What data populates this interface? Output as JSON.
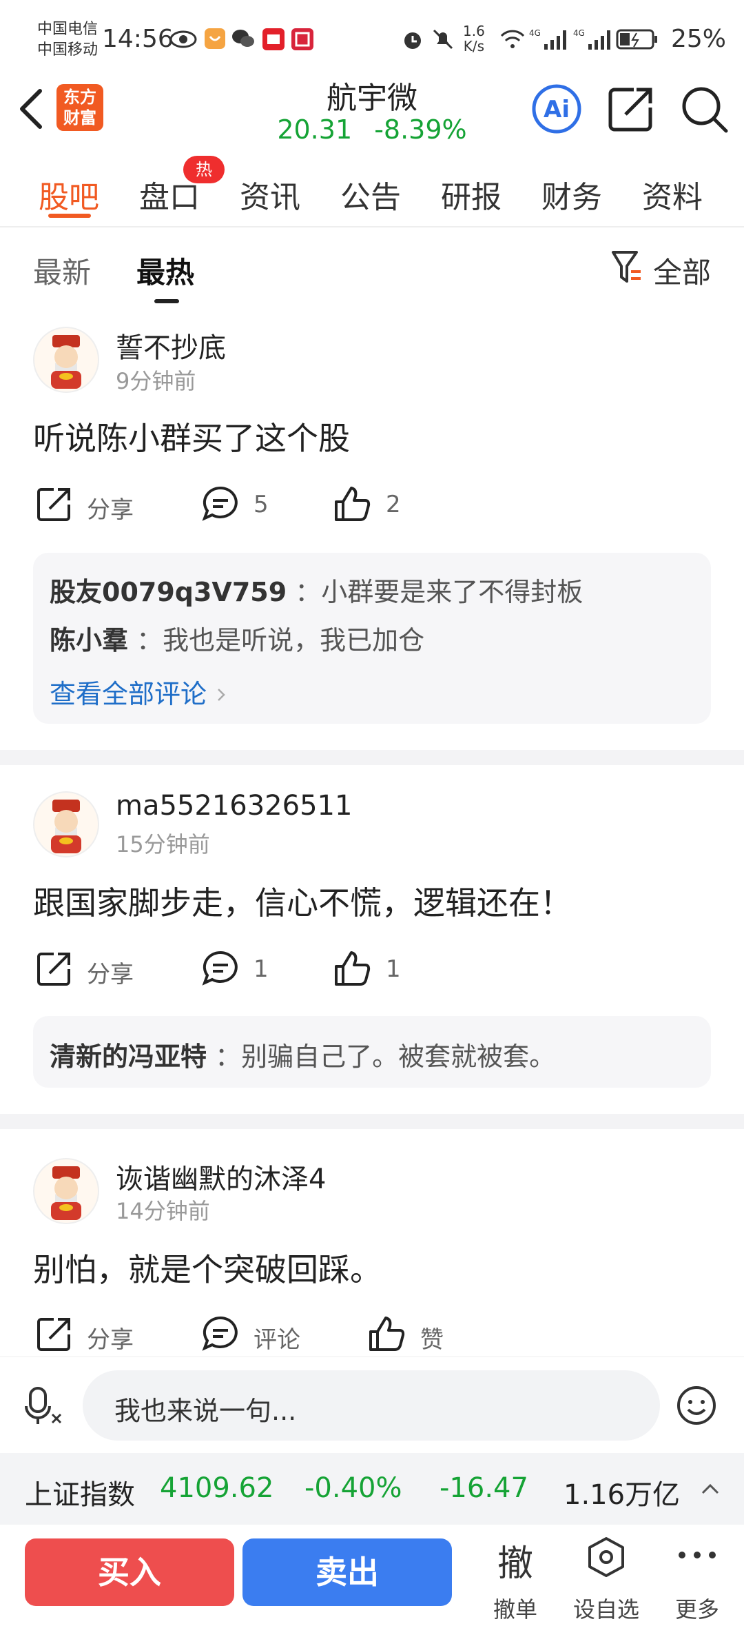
{
  "status_bar": {
    "carrier1": "中国电信",
    "carrier2": "中国移动",
    "time": "14:56",
    "net_speed_top": "1.6",
    "net_speed_bottom": "K/s",
    "net1": "4G",
    "net2": "4G",
    "battery": "25%"
  },
  "header": {
    "logo_line1": "东方",
    "logo_line2": "财富",
    "stock_name": "航宇微",
    "price": "20.31",
    "change_pct": "-8.39%",
    "ai_label": "Ai",
    "quote_color": "#15a335",
    "brand_color": "#f15a22"
  },
  "tabs": [
    {
      "label": "股吧",
      "active": true
    },
    {
      "label": "盘口"
    },
    {
      "label": "资讯"
    },
    {
      "label": "公告"
    },
    {
      "label": "研报"
    },
    {
      "label": "财务"
    },
    {
      "label": "资料"
    }
  ],
  "hot_badge": "热",
  "subtabs": {
    "latest": "最新",
    "hottest": "最热",
    "filter_label": "全部"
  },
  "posts": [
    {
      "user": "誓不抄底",
      "time": "9分钟前",
      "text": "听说陈小群买了这个股",
      "share": "分享",
      "comments": "5",
      "likes": "2",
      "replies": [
        {
          "user": "股友0079q3V759",
          "text": "：小群要是来了不得封板"
        },
        {
          "user": "陈小羣",
          "text": "：我也是听说，我已加仓"
        }
      ],
      "view_all": "查看全部评论"
    },
    {
      "user": "ma55216326511",
      "time": "15分钟前",
      "text": "跟国家脚步走，信心不慌，逻辑还在！",
      "share": "分享",
      "comments": "1",
      "likes": "1",
      "replies": [
        {
          "user": "清新的冯亚特",
          "text": "：别骗自己了。被套就被套。"
        }
      ]
    },
    {
      "user": "诙谐幽默的沐泽4",
      "time": "14分钟前",
      "text": "别怕，就是个突破回踩。",
      "share": "分享",
      "comments": "评论",
      "likes": "赞"
    }
  ],
  "input": {
    "placeholder": "我也来说一句..."
  },
  "index_bar": {
    "name": "上证指数",
    "value": "4109.62",
    "pct": "-0.40%",
    "change": "-16.47",
    "volume": "1.16万亿"
  },
  "bottom": {
    "buy": "买入",
    "sell": "卖出",
    "cancel_glyph": "撤",
    "cancel": "撤单",
    "watch": "设自选",
    "more": "更多"
  }
}
